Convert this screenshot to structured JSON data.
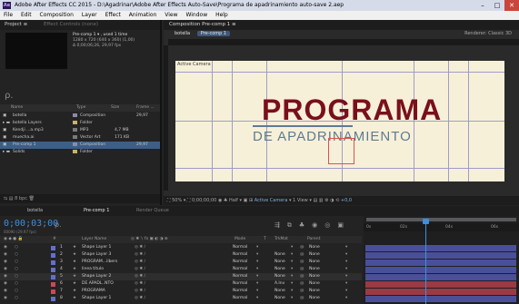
{
  "window": {
    "title": "Adobe After Effects CC 2015 - D:\\Agadrinar\\Adobe After Effects Auto-Save\\Programa de apadrinamiento auto-save 2.aep",
    "app_icon": "Ae",
    "buttons": {
      "minimize": "–",
      "maximize": "□",
      "close": "✕"
    }
  },
  "menu": [
    "File",
    "Edit",
    "Composition",
    "Layer",
    "Effect",
    "Animation",
    "View",
    "Window",
    "Help"
  ],
  "project": {
    "tab": "Project ≡",
    "tab2": "Effect Controls (none)",
    "selected_name": "Pre-comp 1 ▾ , used 1 time",
    "selected_info1": "1280 x 720  (640 x 360) (1,00)",
    "selected_info2": "Δ 0;00;06;26, 29,97 fps",
    "search_icon": "ρ.",
    "columns": [
      "Name",
      "Type",
      "Size",
      "Frame ..."
    ],
    "items": [
      {
        "name": "botella",
        "type": "Composition",
        "size": "",
        "fps": "29,97",
        "color": "#8a8aa8",
        "icon": "comp",
        "selected": false
      },
      {
        "name": "botella Layers",
        "type": "Folder",
        "size": "",
        "fps": "",
        "color": "#c8b26a",
        "icon": "folder",
        "selected": false
      },
      {
        "name": "Kendji ...a.mp3",
        "type": "MP3",
        "size": "4,7 MB",
        "fps": "",
        "color": "#7a7a7a",
        "icon": "audio",
        "selected": false
      },
      {
        "name": "muecha.ai",
        "type": "Vector Art",
        "size": "171 KB",
        "fps": "",
        "color": "#7a7a7a",
        "icon": "ai",
        "selected": false
      },
      {
        "name": "Pre-comp 1",
        "type": "Composition",
        "size": "",
        "fps": "29,97",
        "color": "#8a8aa8",
        "icon": "comp",
        "selected": true
      },
      {
        "name": "Solids",
        "type": "Folder",
        "size": "",
        "fps": "",
        "color": "#c8b26a",
        "icon": "folder",
        "selected": false
      }
    ],
    "footer_bpc": "8 bpc"
  },
  "composition": {
    "panel_title": "Composition Pre-comp 1  ≡",
    "tab1": "botella",
    "tab2": "Pre-comp 1",
    "renderer": "Renderer:  Classic 3D",
    "ruler_ticks": [
      "150",
      "200",
      "250",
      "300",
      "350",
      "400",
      "450",
      "500",
      "550",
      "600",
      "650",
      "1000",
      "1050",
      "1100",
      "1150",
      "1200",
      "1250",
      "1300"
    ],
    "active_camera_label": "Active Camera",
    "text_main": "PROGRAMA",
    "text_sub": "DE APADRINAMIENTO",
    "footer": {
      "zoom": "50%",
      "timecode": "0;00;00;00",
      "quality": "Half",
      "view": "Active Camera",
      "views": "1 View",
      "offset": "+0,0"
    }
  },
  "timeline": {
    "tabs": [
      "botella",
      "Pre-comp 1",
      "Render Queue"
    ],
    "timecode": "0;00;03;00",
    "timecode_sub": "00090 (29.97 fps)",
    "search_icon": "ρ.",
    "columns": [
      "#",
      "Layer Name",
      "Mode",
      "T",
      "TrkMat",
      "Parent"
    ],
    "ruler": [
      "0s",
      "02s",
      "04s",
      "06s"
    ],
    "layers": [
      {
        "num": "1",
        "name": "Shape Layer 1",
        "mode": "Normal",
        "trkmat": "",
        "parent": "None",
        "color": "#6470c8",
        "bar": "#4a4f9a"
      },
      {
        "num": "2",
        "name": "Shape Layer 3",
        "mode": "Normal",
        "trkmat": "None",
        "parent": "None",
        "color": "#6470c8",
        "bar": "#4a4f9a"
      },
      {
        "num": "3",
        "name": "PROGRAM...ilbers",
        "mode": "Normal",
        "trkmat": "None",
        "parent": "None",
        "color": "#6470c8",
        "bar": "#4a4f9a"
      },
      {
        "num": "4",
        "name": "linea titulo",
        "mode": "Normal",
        "trkmat": "None",
        "parent": "None",
        "color": "#6470c8",
        "bar": "#4a4f9a"
      },
      {
        "num": "5",
        "name": "Shape Layer 2",
        "mode": "Normal",
        "trkmat": "None",
        "parent": "None",
        "color": "#6470c8",
        "bar": "#4a4f9a"
      },
      {
        "num": "6",
        "name": "DE APADL..NTO",
        "mode": "Normal",
        "trkmat": "A.Inv",
        "parent": "None",
        "color": "#c84a55",
        "bar": "#9a3a45"
      },
      {
        "num": "7",
        "name": "PROGRAMA",
        "mode": "Normal",
        "trkmat": "None",
        "parent": "None",
        "color": "#c84a55",
        "bar": "#9a3a45"
      },
      {
        "num": "8",
        "name": "Shape Layer 1",
        "mode": "Normal",
        "trkmat": "None",
        "parent": "None",
        "color": "#6470c8",
        "bar": "#4a4f9a"
      }
    ]
  }
}
